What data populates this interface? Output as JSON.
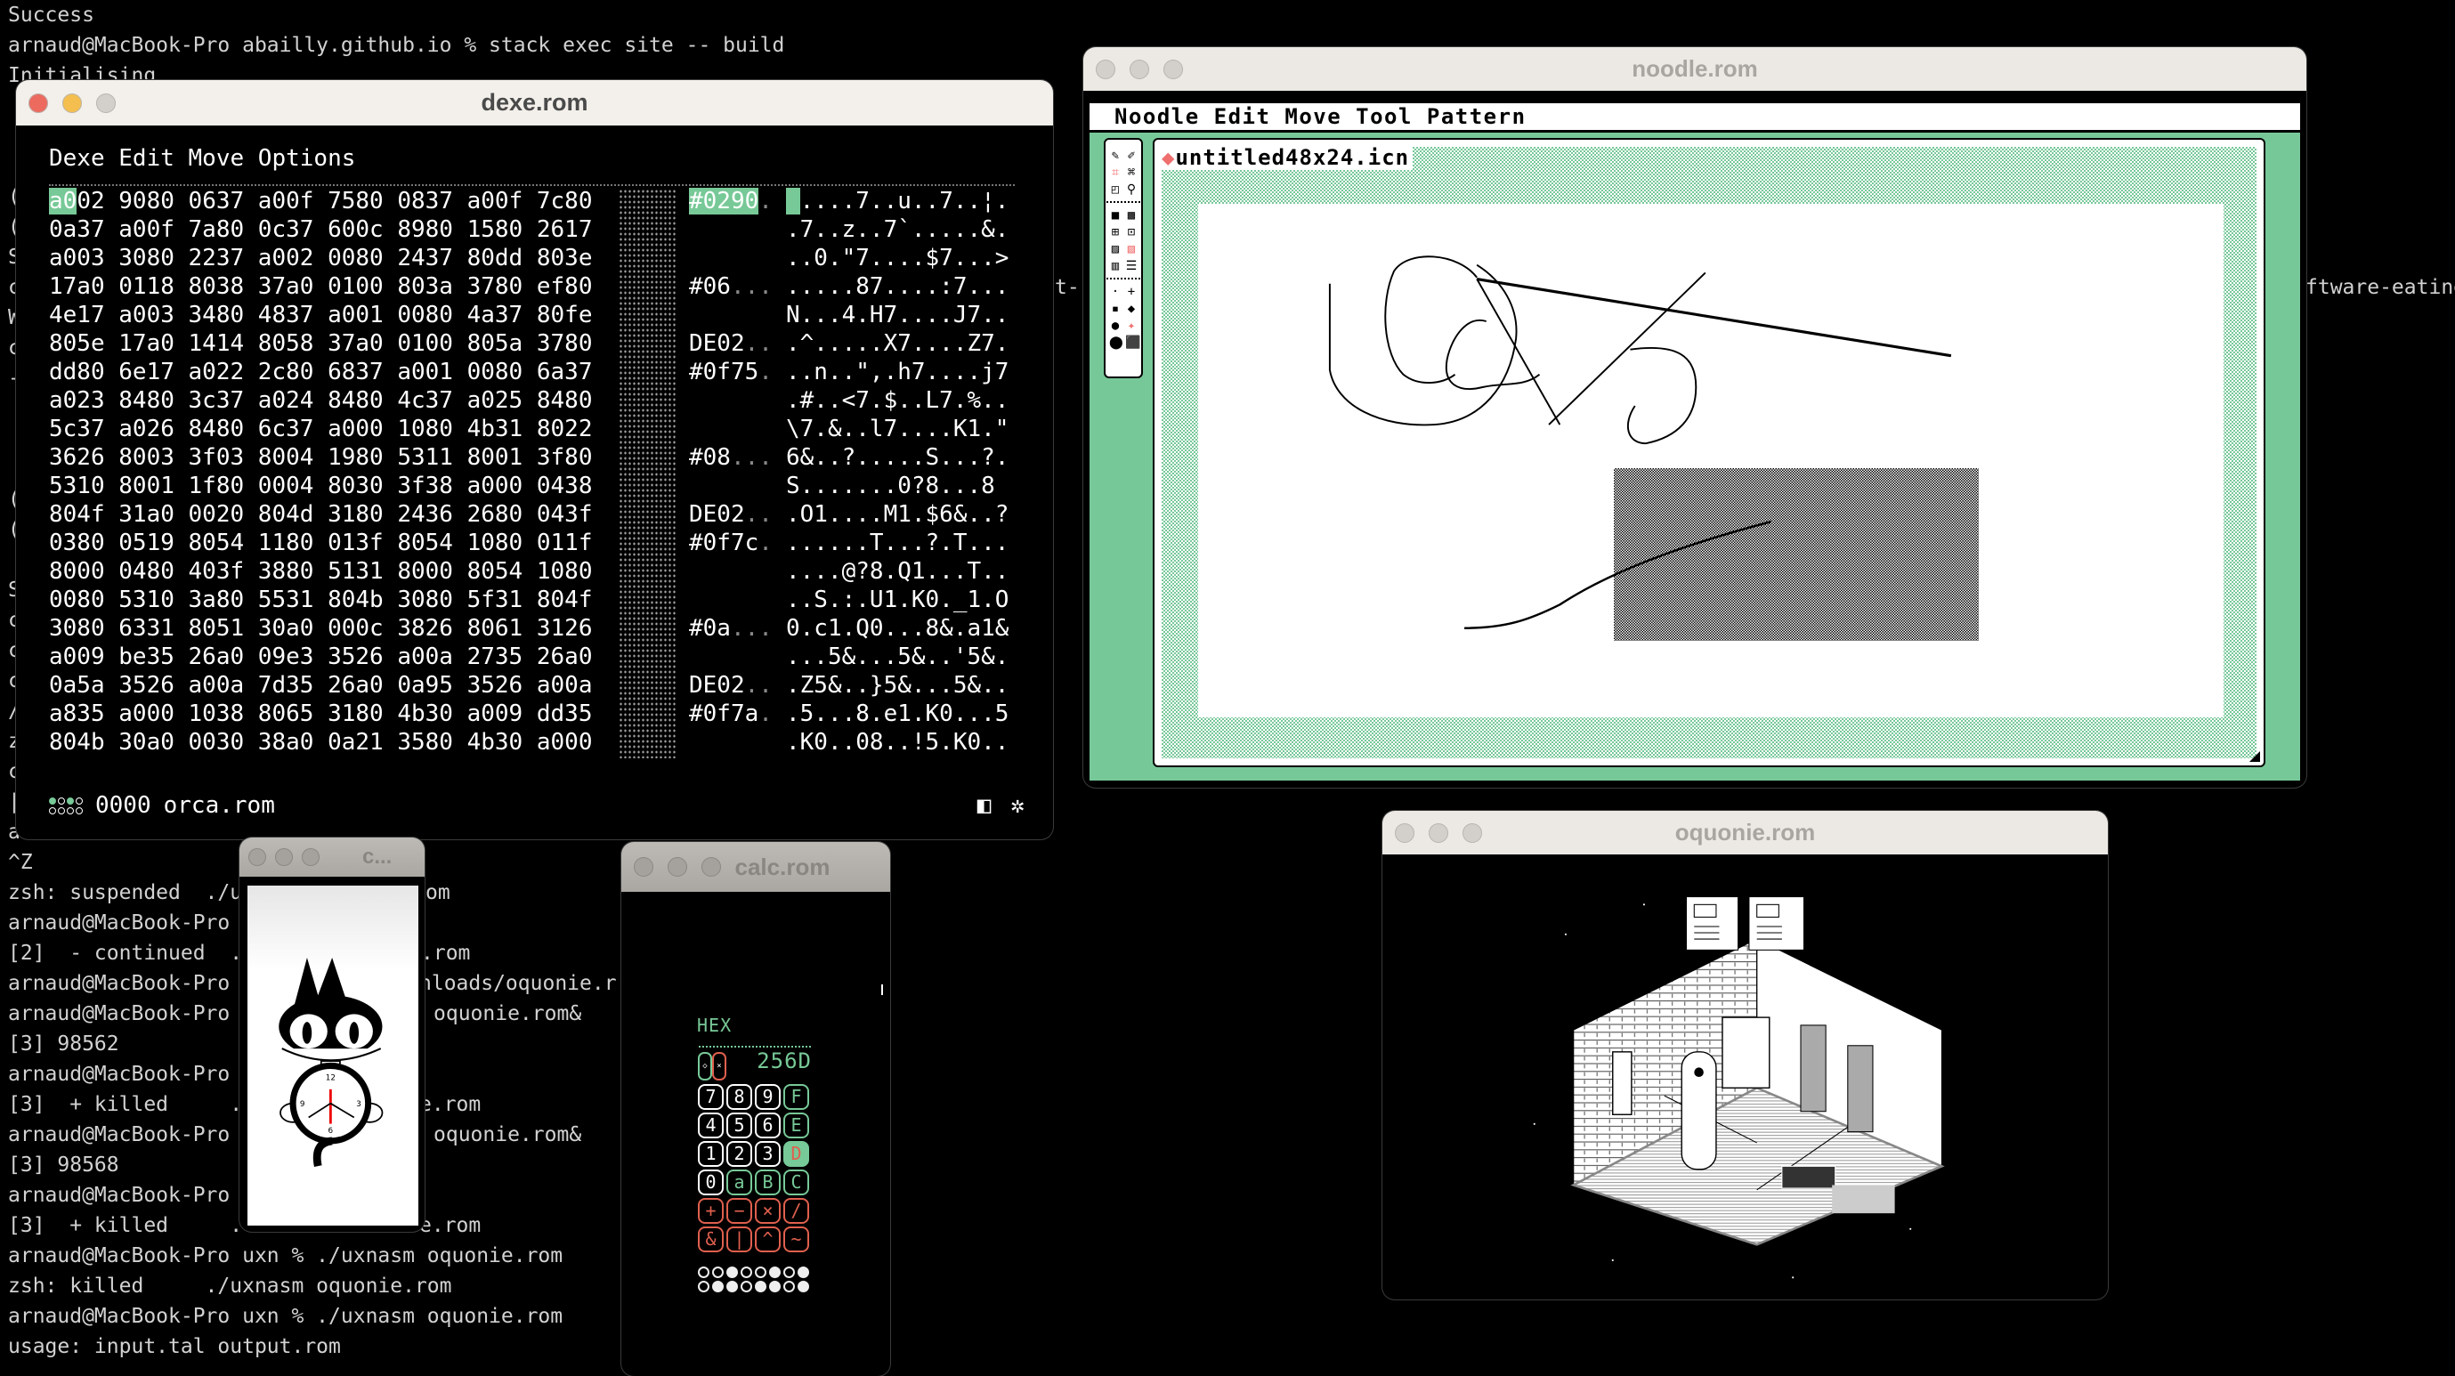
{
  "terminal": {
    "lines": [
      {
        "text": "Success"
      },
      {
        "text": "arnaud@MacBook-Pro abailly.github.io % stack exec site -- build"
      },
      {
        "text": "Initialising"
      },
      {
        "text": ""
      },
      {
        "text": ""
      },
      {
        "text": ""
      },
      {
        "text": "("
      },
      {
        "text": "("
      },
      {
        "text": "S"
      },
      {
        "text": "c",
        "tails": [
          "t-",
          "ftware-eating"
        ]
      },
      {
        "text": "W"
      },
      {
        "text": "c"
      },
      {
        "text": "-"
      },
      {
        "text": ""
      },
      {
        "text": ""
      },
      {
        "text": ""
      },
      {
        "text": "("
      },
      {
        "text": "("
      },
      {
        "text": ""
      },
      {
        "text": "S"
      },
      {
        "text": "c"
      },
      {
        "text": "c"
      },
      {
        "text": "c"
      },
      {
        "text": "/"
      },
      {
        "text": "z"
      },
      {
        "text": "c"
      },
      {
        "text": "|"
      },
      {
        "text": "a"
      },
      {
        "text": "^Z"
      },
      {
        "text": "zsh: suspended  ./u",
        "tails": [
          "om"
        ]
      },
      {
        "text": "arnaud@MacBook-Pro"
      },
      {
        "text": "[2]  - continued  .",
        "tails": [
          ".rom"
        ]
      },
      {
        "text": "arnaud@MacBook-Pro",
        "tails": [
          "nloads/oquonie.r"
        ]
      },
      {
        "text": "arnaud@MacBook-Pro",
        "tails": [
          "oquonie.rom&"
        ]
      },
      {
        "text": "[3] 98562"
      },
      {
        "text": "arnaud@MacBook-Pro"
      },
      {
        "text": "[3]  + killed     .",
        "tails": [
          "e.rom"
        ]
      },
      {
        "text": "arnaud@MacBook-Pro",
        "tails": [
          "oquonie.rom&"
        ]
      },
      {
        "text": "[3] 98568"
      },
      {
        "text": "arnaud@MacBook-Pro"
      },
      {
        "text": "[3]  + killed     .",
        "tails": [
          "e.rom"
        ]
      },
      {
        "text": "arnaud@MacBook-Pro uxn % ./uxnasm oquonie.rom"
      },
      {
        "text": "zsh: killed     ./uxnasm oquonie.rom"
      },
      {
        "text": "arnaud@MacBook-Pro uxn % ./uxnasm oquonie.rom"
      },
      {
        "text": "usage: input.tal output.rom"
      }
    ]
  },
  "dexe": {
    "title": "dexe.rom",
    "menu": "Dexe Edit Move Options",
    "cursor_hex": "a0",
    "rows": [
      {
        "hex": "02 9080 0637 a00f 7580 0837 a00f 7c80",
        "label": "#0290",
        "label_dots": ".",
        "ascii": "....7..u..7..¦."
      },
      {
        "hex": "0a37 a00f 7a80 0c37 600c 8980 1580 2617",
        "label": "",
        "label_dots": "",
        "ascii": ".7..z..7`.....&."
      },
      {
        "hex": "a003 3080 2237 a002 0080 2437 80dd 803e",
        "label": "",
        "label_dots": "",
        "ascii": "..0.\"7....$7...>"
      },
      {
        "hex": "17a0 0118 8038 37a0 0100 803a 3780 ef80",
        "label": "#06",
        "label_dots": "...",
        "ascii": ".....87....:7..."
      },
      {
        "hex": "4e17 a003 3480 4837 a001 0080 4a37 80fe",
        "label": "",
        "label_dots": "",
        "ascii": "N...4.H7....J7.."
      },
      {
        "hex": "805e 17a0 1414 8058 37a0 0100 805a 3780",
        "label": "DE02",
        "label_dots": "..",
        "ascii": ".^.....X7....Z7."
      },
      {
        "hex": "dd80 6e17 a022 2c80 6837 a001 0080 6a37",
        "label": "#0f75",
        "label_dots": ".",
        "ascii": "..n..\",.h7....j7"
      },
      {
        "hex": "a023 8480 3c37 a024 8480 4c37 a025 8480",
        "label": "",
        "label_dots": "",
        "ascii": ".#..<7.$..L7.%.."
      },
      {
        "hex": "5c37 a026 8480 6c37 a000 1080 4b31 8022",
        "label": "",
        "label_dots": "",
        "ascii": "\\7.&..l7....K1.\""
      },
      {
        "hex": "3626 8003 3f03 8004 1980 5311 8001 3f80",
        "label": "#08",
        "label_dots": "...",
        "ascii": "6&..?.....S...?."
      },
      {
        "hex": "5310 8001 1f80 0004 8030 3f38 a000 0438",
        "label": "",
        "label_dots": "",
        "ascii": "S.......0?8...8"
      },
      {
        "hex": "804f 31a0 0020 804d 3180 2436 2680 043f",
        "label": "DE02",
        "label_dots": "..",
        "ascii": ".O1....M1.$6&..?"
      },
      {
        "hex": "0380 0519 8054 1180 013f 8054 1080 011f",
        "label": "#0f7c",
        "label_dots": ".",
        "ascii": "......T...?.T..."
      },
      {
        "hex": "8000 0480 403f 3880 5131 8000 8054 1080",
        "label": "",
        "label_dots": "",
        "ascii": "....@?8.Q1...T.."
      },
      {
        "hex": "0080 5310 3a80 5531 804b 3080 5f31 804f",
        "label": "",
        "label_dots": "",
        "ascii": "..S.:.U1.K0._1.O"
      },
      {
        "hex": "3080 6331 8051 30a0 000c 3826 8061 3126",
        "label": "#0a",
        "label_dots": "...",
        "ascii": "0.c1.Q0...8&.a1&"
      },
      {
        "hex": "a009 be35 26a0 09e3 3526 a00a 2735 26a0",
        "label": "",
        "label_dots": "",
        "ascii": "...5&...5&..'5&."
      },
      {
        "hex": "0a5a 3526 a00a 7d35 26a0 0a95 3526 a00a",
        "label": "DE02",
        "label_dots": "..",
        "ascii": ".Z5&..}5&...5&.."
      },
      {
        "hex": "a835 a000 1038 8065 3180 4b30 a009 dd35",
        "label": "#0f7a",
        "label_dots": ".",
        "ascii": ".5...8.e1.K0...5"
      },
      {
        "hex": "804b 30a0 0030 38a0 0a21 3580 4b30 a000",
        "label": "",
        "label_dots": "",
        "ascii": ".K0..08..!5.K0.."
      }
    ],
    "footer": {
      "address": "0000",
      "filename": "orca.rom",
      "icon_left": "◧",
      "icon_right": "✲"
    }
  },
  "noodle": {
    "title": "noodle.rom",
    "menu": "Noodle Edit Move Tool Pattern",
    "filename": "untitled48x24.icn",
    "palette": [
      [
        {
          "icon": "pencil-icon",
          "glyph": "✎"
        },
        {
          "icon": "eraser-icon",
          "glyph": "✐"
        }
      ],
      [
        {
          "icon": "select-icon",
          "glyph": "⌗",
          "red": true
        },
        {
          "icon": "crosshair-icon",
          "glyph": "⌘"
        }
      ],
      [
        {
          "icon": "lasso-icon",
          "glyph": "◰"
        },
        {
          "icon": "zoom-icon",
          "glyph": "⚲"
        }
      ],
      "sep",
      [
        {
          "icon": "pattern-solid-icon",
          "glyph": "■"
        },
        {
          "icon": "pattern-checker-icon",
          "glyph": "▩"
        }
      ],
      [
        {
          "icon": "pattern-dots-icon",
          "glyph": "⊞"
        },
        {
          "icon": "pattern-diamond-icon",
          "glyph": "⊡"
        }
      ],
      [
        {
          "icon": "pattern-diag-icon",
          "glyph": "▨"
        },
        {
          "icon": "pattern-diag-alt-icon",
          "glyph": "▧",
          "red": true
        }
      ],
      [
        {
          "icon": "pattern-vlines-icon",
          "glyph": "▥"
        },
        {
          "icon": "pattern-hlines-icon",
          "glyph": "☰"
        }
      ],
      "sep",
      [
        {
          "icon": "brush-1-icon",
          "glyph": "·"
        },
        {
          "icon": "brush-2-icon",
          "glyph": "+"
        }
      ],
      [
        {
          "icon": "brush-3-icon",
          "glyph": "▪"
        },
        {
          "icon": "brush-4-icon",
          "glyph": "◆"
        }
      ],
      [
        {
          "icon": "brush-5-icon",
          "glyph": "●"
        },
        {
          "icon": "brush-6-icon",
          "glyph": "✦",
          "red": true
        }
      ],
      [
        {
          "icon": "brush-7-icon",
          "glyph": "⬤"
        },
        {
          "icon": "brush-8-icon",
          "glyph": "⬛"
        }
      ]
    ]
  },
  "oquonie": {
    "title": "oquonie.rom"
  },
  "calc": {
    "title": "calc.rom",
    "mode": "HEX",
    "toggles": [
      "◇",
      "×"
    ],
    "display": "256D",
    "buttons": [
      {
        "label": "7",
        "kind": "w"
      },
      {
        "label": "8",
        "kind": "w"
      },
      {
        "label": "9",
        "kind": "w"
      },
      {
        "label": "F",
        "kind": "g"
      },
      {
        "label": "4",
        "kind": "w"
      },
      {
        "label": "5",
        "kind": "w"
      },
      {
        "label": "6",
        "kind": "w"
      },
      {
        "label": "E",
        "kind": "g"
      },
      {
        "label": "1",
        "kind": "w"
      },
      {
        "label": "2",
        "kind": "w"
      },
      {
        "label": "3",
        "kind": "w"
      },
      {
        "label": "D",
        "kind": "act"
      },
      {
        "label": "0",
        "kind": "w"
      },
      {
        "label": "a",
        "kind": "g"
      },
      {
        "label": "B",
        "kind": "g"
      },
      {
        "label": "C",
        "kind": "g"
      },
      {
        "label": "+",
        "kind": "r"
      },
      {
        "label": "−",
        "kind": "r"
      },
      {
        "label": "×",
        "kind": "r"
      },
      {
        "label": "/",
        "kind": "r"
      },
      {
        "label": "&",
        "kind": "r"
      },
      {
        "label": "|",
        "kind": "r"
      },
      {
        "label": "^",
        "kind": "r"
      },
      {
        "label": "~",
        "kind": "r"
      }
    ],
    "bits": [
      0,
      0,
      1,
      0,
      0,
      1,
      0,
      1,
      0,
      1,
      1,
      0,
      1,
      1,
      0,
      1
    ]
  },
  "catclock": {
    "title": "c..."
  },
  "colors": {
    "accent_green": "#77c997",
    "accent_red": "#e0604e",
    "noodle_green": "#77c899"
  }
}
